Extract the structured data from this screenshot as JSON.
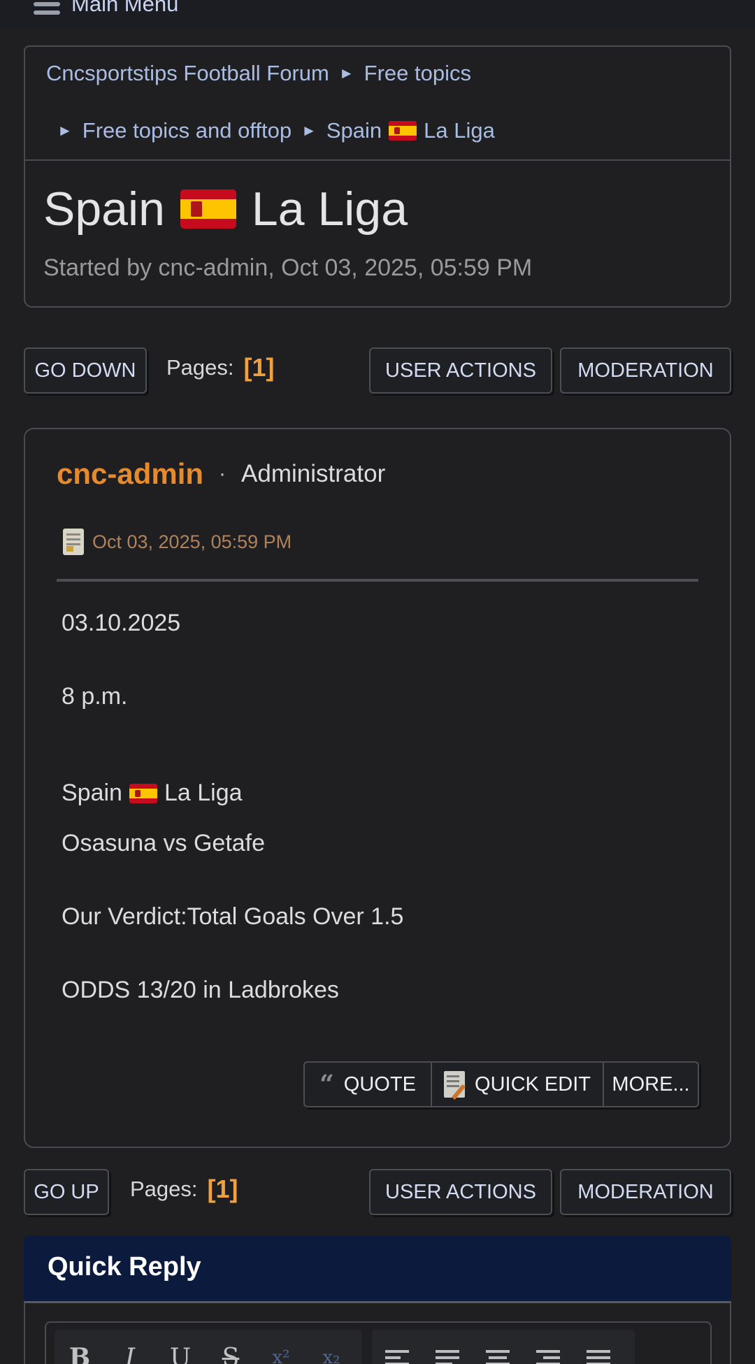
{
  "top_menu": {
    "label": "Main Menu"
  },
  "breadcrumb": {
    "items": [
      "Cncsportstips Football Forum",
      "Free topics",
      "Free topics and offtop",
      "Spain",
      "La Liga"
    ],
    "separator": "►"
  },
  "topic": {
    "title_prefix": "Spain",
    "title_suffix": "La Liga",
    "started_by": "Started by cnc-admin, Oct 03, 2025, 05:59 PM"
  },
  "pagination_top": {
    "go_label": "GO DOWN",
    "pages_label": "Pages:",
    "current_page": "[1]",
    "user_actions": "USER ACTIONS",
    "moderation": "MODERATION"
  },
  "post": {
    "author": "cnc-admin",
    "separator": "·",
    "role": "Administrator",
    "date": "Oct 03, 2025, 05:59 PM",
    "lines": [
      "03.10.2025",
      "8 p.m.",
      "Spain",
      "La Liga",
      "Osasuna vs Getafe",
      "Our Verdict:Total Goals Over 1.5",
      "ODDS 13/20 in Ladbrokes"
    ],
    "actions": {
      "quote": "QUOTE",
      "quick_edit": "QUICK EDIT",
      "more": "MORE..."
    }
  },
  "pagination_bottom": {
    "go_label": "GO UP",
    "pages_label": "Pages:",
    "current_page": "[1]",
    "user_actions": "USER ACTIONS",
    "moderation": "MODERATION"
  },
  "quick_reply": {
    "title": "Quick Reply",
    "toolbar": {
      "bold": "B",
      "italic": "I",
      "underline": "U",
      "strike": "S",
      "sup": "x²",
      "sub": "x₂"
    }
  },
  "colors": {
    "background": "#1f1f21",
    "link": "#a9bde3",
    "accent": "#e68a2e",
    "page_number": "#f0a03c",
    "quick_reply_header": "#0b1a3d"
  }
}
